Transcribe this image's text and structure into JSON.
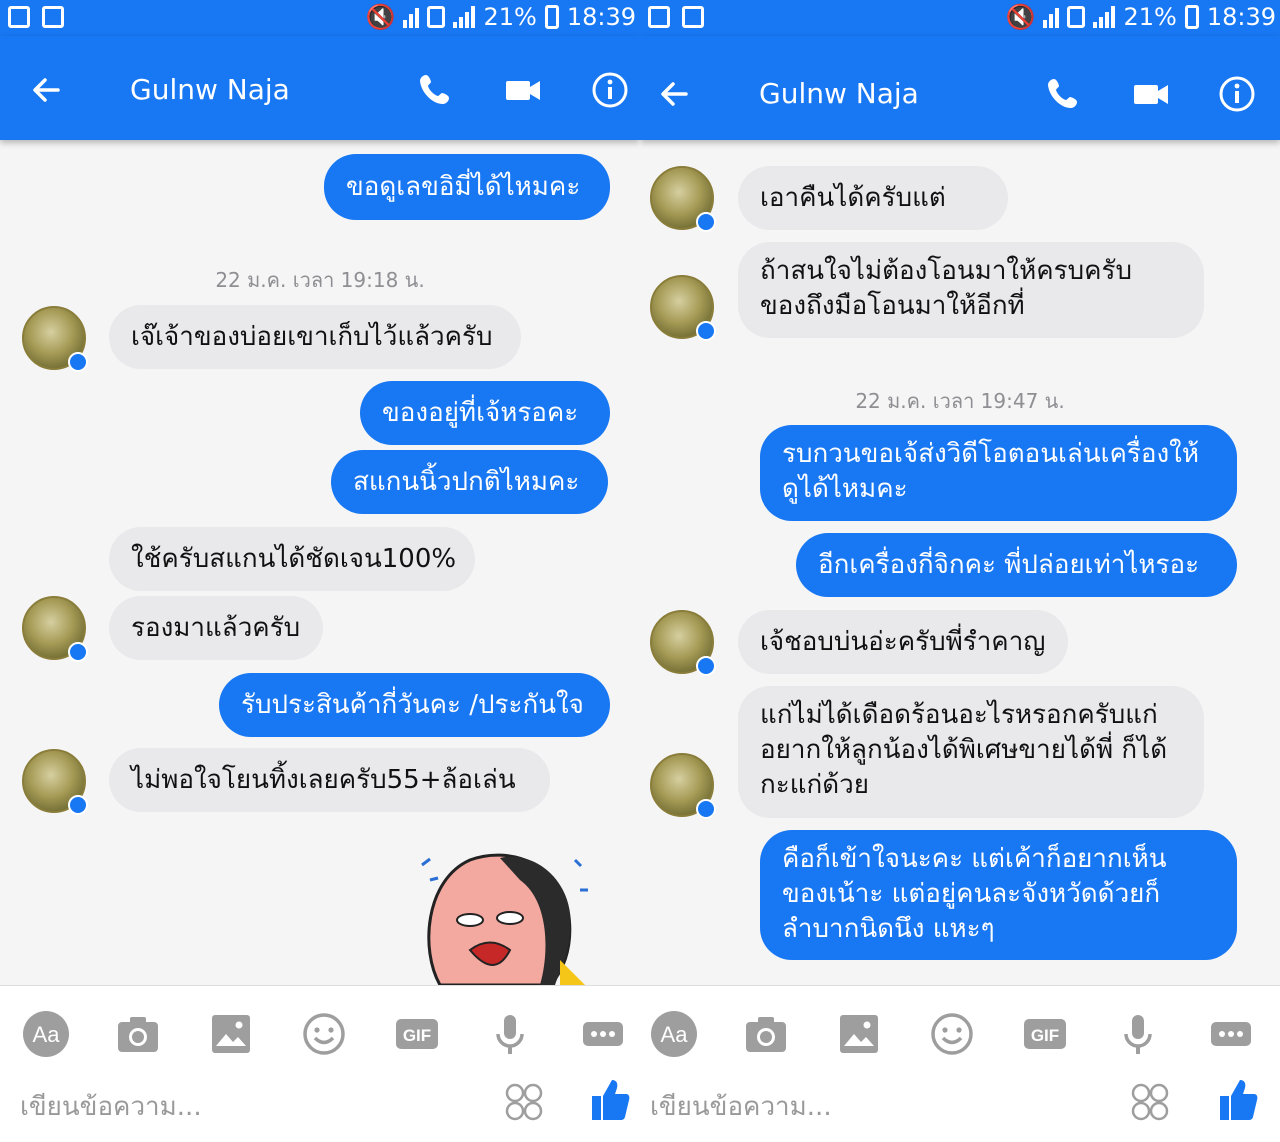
{
  "left": {
    "status": {
      "battery": "21%",
      "time": "18:39"
    },
    "header": {
      "contact_name": "Gulnw Naja"
    },
    "messages": {
      "m1": "ขอดูเลขอิมี่ได้ไหมคะ",
      "ts1": "22 ม.ค. เวลา 19:18 น.",
      "m2": "เจ๊เจ้าของบ่อยเขาเก็บไว้แล้วครับ",
      "m3": "ของอยู่ที่เจ้หรอคะ",
      "m4": "สแกนนิ้วปกติไหมคะ",
      "m5": "ใช้ครับสแกนได้ชัดเจน100%",
      "m6": "รองมาแล้วครับ",
      "m7": "รับประสินค้ากี่วันคะ  /ประกันใจ",
      "m8": "ไม่พอใจโยนทิ้งเลยครับ55+ล้อเล่น"
    },
    "composer": {
      "placeholder": "เขียนข้อความ..."
    }
  },
  "right": {
    "status": {
      "battery": "21%",
      "time": "18:39"
    },
    "header": {
      "contact_name": "Gulnw Naja"
    },
    "messages": {
      "m1": "เอาคืนได้ครับแต่",
      "m2": "ถ้าสนใจไม่ต้องโอนมาให้ครบครับ ของถึงมือโอนมาให้อีกที่",
      "ts1": "22 ม.ค. เวลา 19:47 น.",
      "m3": "รบกวนขอเจ้ส่งวิดีโอตอนเล่นเครื่องให้ดูได้ไหมคะ",
      "m4": "อีกเครื่องกี่จิกคะ พี่ปล่อยเท่าไหรอะ",
      "m5": "เจ้ชอบบ่นอ่ะครับพี่รำคาญ",
      "m6": "แก่ไม่ได้เดือดร้อนอะไรหรอกครับแก่ อยากให้ลูกน้องได้พิเศษขายได้พี่ ก็ได้กะแก่ด้วย",
      "m7": "คือก็เข้าใจนะคะ แต่เค้าก็อยากเห็น ของเน้าะ แต่อยู่คนละจังหวัดด้วยก็ ลำบากนิดนึง แหะๆ"
    },
    "composer": {
      "placeholder": "เขียนข้อความ..."
    }
  },
  "colors": {
    "brand": "#1877f2",
    "incoming_bubble": "#e9e9ec"
  }
}
